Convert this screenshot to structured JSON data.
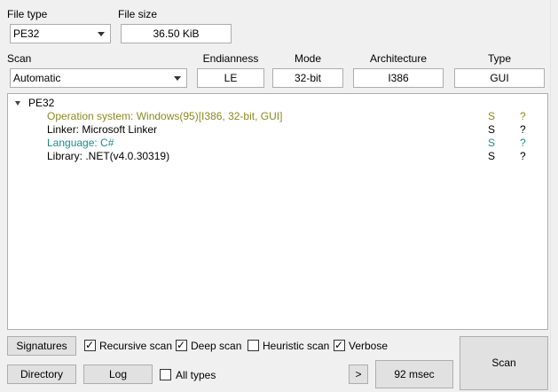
{
  "file_type": {
    "label": "File type",
    "value": "PE32"
  },
  "file_size": {
    "label": "File size",
    "value": "36.50 KiB"
  },
  "scan": {
    "label": "Scan",
    "value": "Automatic"
  },
  "endianness": {
    "label": "Endianness",
    "value": "LE"
  },
  "mode": {
    "label": "Mode",
    "value": "32-bit"
  },
  "architecture": {
    "label": "Architecture",
    "value": "I386"
  },
  "type": {
    "label": "Type",
    "value": "GUI"
  },
  "results": {
    "root": "PE32",
    "items": [
      {
        "text": "Operation system: Windows(95)[I386, 32-bit, GUI]",
        "s": "S",
        "q": "?",
        "color": "#8c8b1e"
      },
      {
        "text": "Linker: Microsoft Linker",
        "s": "S",
        "q": "?",
        "color": "#000000"
      },
      {
        "text": "Language: C#",
        "s": "S",
        "q": "?",
        "color": "#1d8a8e"
      },
      {
        "text": "Library: .NET(v4.0.30319)",
        "s": "S",
        "q": "?",
        "color": "#000000"
      }
    ]
  },
  "buttons": {
    "signatures": "Signatures",
    "directory": "Directory",
    "log": "Log",
    "more": ">",
    "time": "92 msec",
    "scan": "Scan"
  },
  "options": {
    "recursive_scan": {
      "label": "Recursive scan",
      "checked": true
    },
    "deep_scan": {
      "label": "Deep scan",
      "checked": true
    },
    "heuristic_scan": {
      "label": "Heuristic scan",
      "checked": false
    },
    "verbose": {
      "label": "Verbose",
      "checked": true
    },
    "all_types": {
      "label": "All types",
      "checked": false
    }
  }
}
